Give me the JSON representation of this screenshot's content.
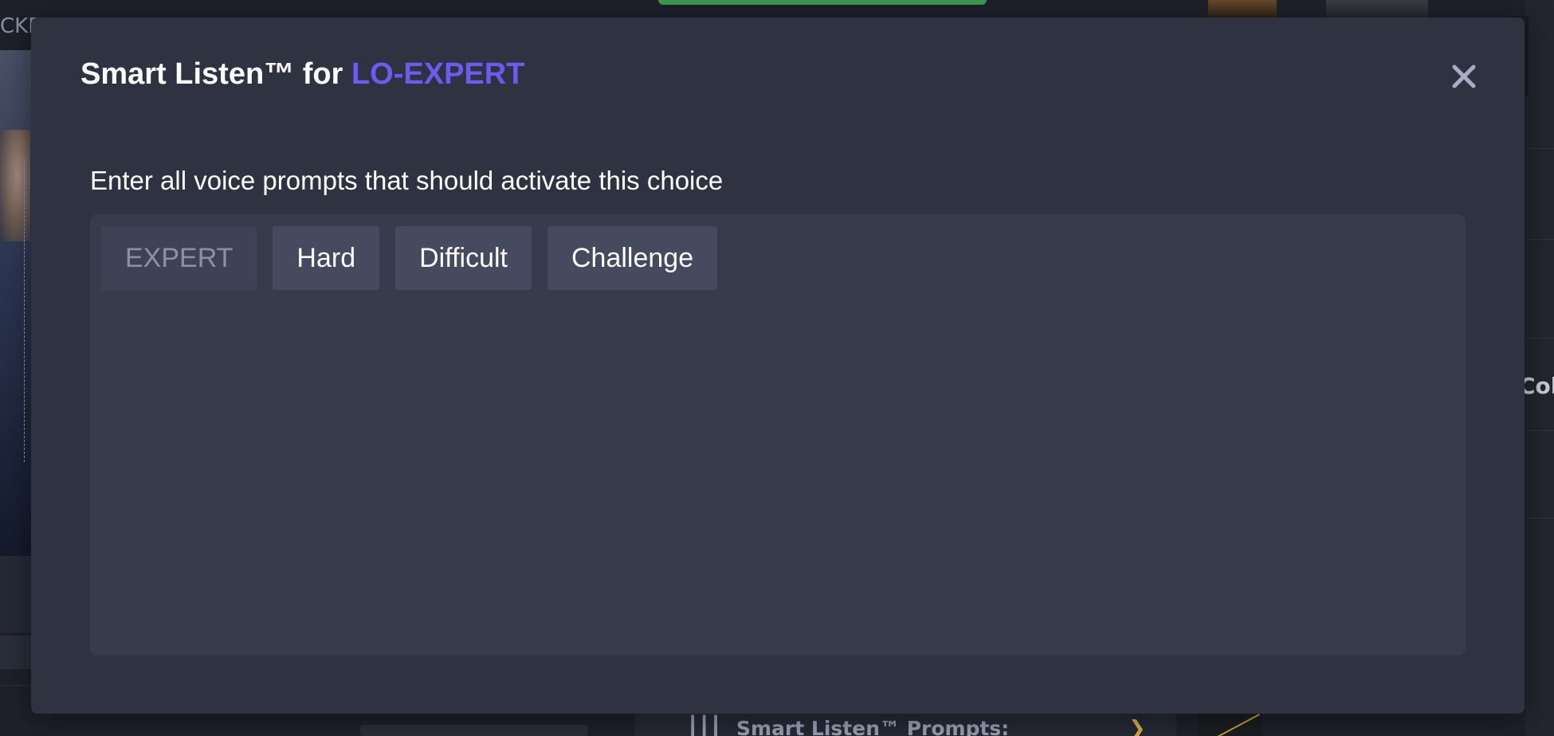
{
  "background": {
    "topbar_fragment": "CKE",
    "side_label_fragment": "Col",
    "bottom_panel_label": "Smart Listen™ Prompts:"
  },
  "modal": {
    "title_prefix": "Smart Listen™ for ",
    "title_choice": "LO-EXPERT",
    "accent_color": "#6a5cf0",
    "close_icon": "close-icon",
    "instruction": "Enter all voice prompts that should activate this choice",
    "prompts": [
      {
        "label": "EXPERT",
        "locked": true
      },
      {
        "label": "Hard",
        "locked": false
      },
      {
        "label": "Difficult",
        "locked": false
      },
      {
        "label": "Challenge",
        "locked": false
      }
    ]
  }
}
